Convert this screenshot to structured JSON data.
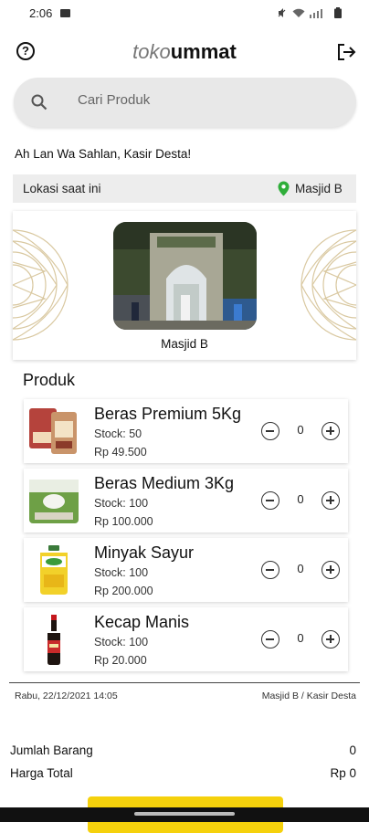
{
  "status_bar": {
    "time": "2:06"
  },
  "header": {
    "brand_light": "toko",
    "brand_bold": "ummat"
  },
  "search": {
    "placeholder": "Cari Produk"
  },
  "greeting": "Ah Lan Wa Sahlan, Kasir Desta!",
  "location": {
    "label": "Lokasi saat ini",
    "value": "Masjid B"
  },
  "mosque_card": {
    "name": "Masjid B"
  },
  "products_title": "Produk",
  "products": [
    {
      "name": "Beras Premium 5Kg",
      "stock": "Stock: 50",
      "price": "Rp 49.500",
      "qty": "0",
      "icon": "rice-bag-premium"
    },
    {
      "name": "Beras Medium 3Kg",
      "stock": "Stock: 100",
      "price": "Rp 100.000",
      "qty": "0",
      "icon": "rice-bag-medium"
    },
    {
      "name": "Minyak Sayur",
      "stock": "Stock: 100",
      "price": "Rp 200.000",
      "qty": "0",
      "icon": "cooking-oil-bottle"
    },
    {
      "name": "Kecap Manis",
      "stock": "Stock: 100",
      "price": "Rp 20.000",
      "qty": "0",
      "icon": "soy-sauce-bottle"
    }
  ],
  "footer": {
    "date": "Rabu, 22/12/2021 14:05",
    "info": "Masjid B / Kasir Desta"
  },
  "summary": {
    "items_label": "Jumlah Barang",
    "items_value": "0",
    "total_label": "Harga Total",
    "total_value": "Rp 0"
  },
  "colors": {
    "accent": "#f5d10c",
    "pin": "#2fae3a"
  }
}
